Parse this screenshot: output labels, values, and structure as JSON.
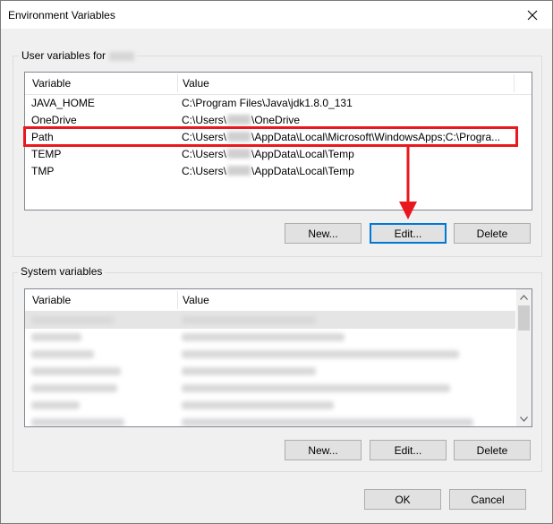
{
  "window": {
    "title": "Environment Variables"
  },
  "user_vars": {
    "group_label": "User variables for",
    "col_variable": "Variable",
    "col_value": "Value",
    "rows": [
      {
        "variable": "JAVA_HOME",
        "value_parts": [
          "C:\\Program Files\\Java\\jdk1.8.0_131"
        ]
      },
      {
        "variable": "OneDrive",
        "value_parts": [
          "C:\\Users\\",
          "\\OneDrive"
        ]
      },
      {
        "variable": "Path",
        "value_parts": [
          "C:\\Users\\",
          "\\AppData\\Local\\Microsoft\\WindowsApps;C:\\Progra..."
        ]
      },
      {
        "variable": "TEMP",
        "value_parts": [
          "C:\\Users\\",
          "\\AppData\\Local\\Temp"
        ]
      },
      {
        "variable": "TMP",
        "value_parts": [
          "C:\\Users\\",
          "\\AppData\\Local\\Temp"
        ]
      }
    ],
    "highlighted_row": "Path",
    "buttons": {
      "new": "New...",
      "edit": "Edit...",
      "delete": "Delete"
    }
  },
  "system_vars": {
    "group_label": "System variables",
    "col_variable": "Variable",
    "col_value": "Value",
    "buttons": {
      "new": "New...",
      "edit": "Edit...",
      "delete": "Delete"
    }
  },
  "footer": {
    "ok": "OK",
    "cancel": "Cancel"
  },
  "colors": {
    "annotation": "#e8181e",
    "focus": "#0078d7"
  }
}
